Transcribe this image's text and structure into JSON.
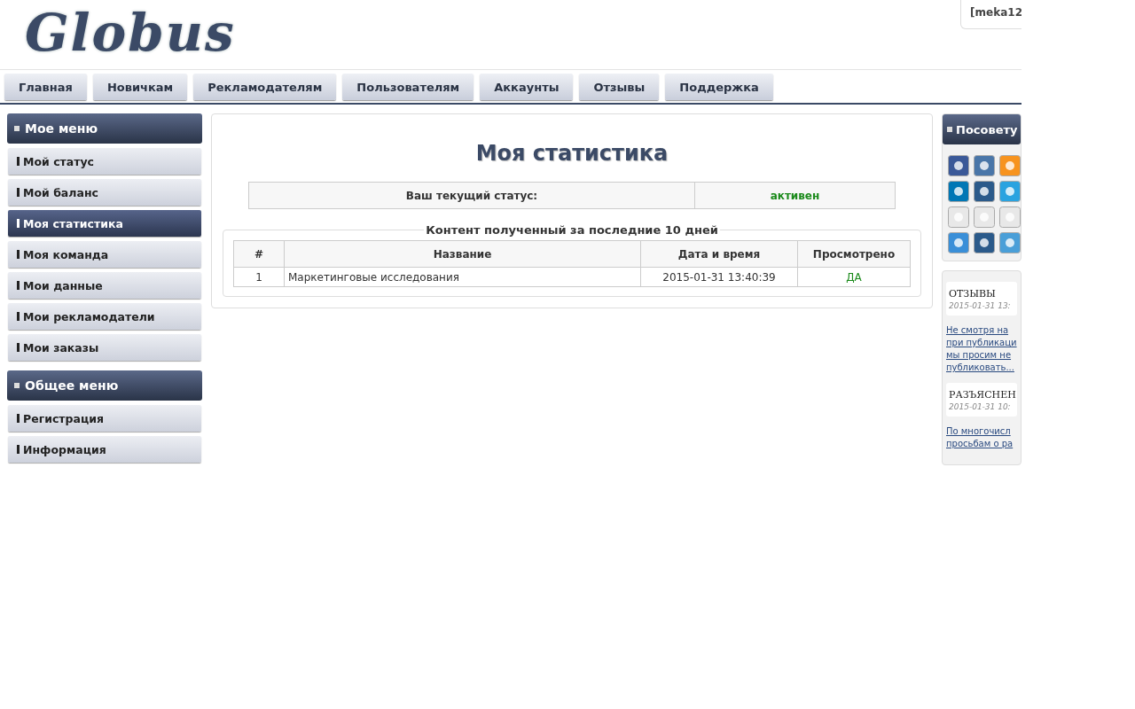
{
  "logo": "Globus",
  "user_badge": "[meka12",
  "nav": [
    {
      "label": "Главная",
      "selected": false
    },
    {
      "label": "Новичкам",
      "selected": false
    },
    {
      "label": "Рекламодателям",
      "selected": false
    },
    {
      "label": "Пользователям",
      "selected": false
    },
    {
      "label": "Аккаунты",
      "selected": false
    },
    {
      "label": "Отзывы",
      "selected": false
    },
    {
      "label": "Поддержка",
      "selected": false
    }
  ],
  "sidebar": [
    {
      "title": "Мое меню",
      "items": [
        {
          "label": "Мой статус",
          "selected": false
        },
        {
          "label": "Мой баланс",
          "selected": false
        },
        {
          "label": "Моя статистика",
          "selected": true
        },
        {
          "label": "Моя команда",
          "selected": false
        },
        {
          "label": "Мои данные",
          "selected": false
        },
        {
          "label": "Мои рекламодатели",
          "selected": false
        },
        {
          "label": "Мои заказы",
          "selected": false
        }
      ]
    },
    {
      "title": "Общее меню",
      "items": [
        {
          "label": "Регистрация",
          "selected": false
        },
        {
          "label": "Информация",
          "selected": false
        }
      ]
    }
  ],
  "main": {
    "title": "Моя статистика",
    "status_label": "Ваш текущий статус:",
    "status_value": "активен",
    "content_legend": "Контент полученный за последние 10 дней",
    "table": {
      "columns": [
        "#",
        "Название",
        "Дата и время",
        "Просмотрено"
      ],
      "rows": [
        [
          "1",
          "Маркетинговые исследования",
          "2015-01-31 13:40:39",
          "ДА"
        ]
      ]
    }
  },
  "share": {
    "title": "Посовету"
  },
  "news": [
    {
      "title": "ОТЗЫВЫ",
      "date": "2015-01-31 13:",
      "lines": [
        "Не смотря на",
        "при публикаци",
        "мы просим не",
        "публиковать..."
      ]
    },
    {
      "title": "РАЗЪЯСНЕН",
      "date": "2015-01-31 10:",
      "lines": [
        "По многочисл",
        "просьбам о ра"
      ]
    }
  ]
}
